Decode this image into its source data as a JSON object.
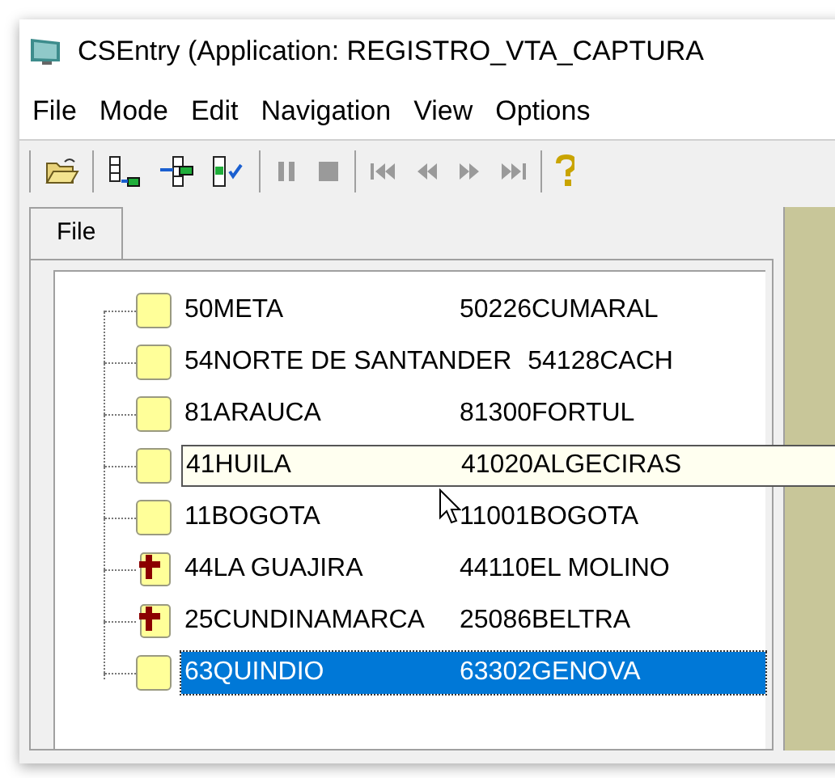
{
  "window": {
    "title": "CSEntry (Application: REGISTRO_VTA_CAPTURA"
  },
  "menu": [
    "File",
    "Mode",
    "Edit",
    "Navigation",
    "View",
    "Options"
  ],
  "toolbar": [
    [
      {
        "kind": "open",
        "disabled": false
      }
    ],
    [
      {
        "kind": "add",
        "disabled": false
      },
      {
        "kind": "insert",
        "disabled": false
      },
      {
        "kind": "verify",
        "disabled": false
      }
    ],
    [
      {
        "kind": "pause",
        "disabled": true
      },
      {
        "kind": "stop",
        "disabled": true
      }
    ],
    [
      {
        "kind": "first",
        "disabled": true
      },
      {
        "kind": "previous",
        "disabled": true
      },
      {
        "kind": "next",
        "disabled": true
      },
      {
        "kind": "last",
        "disabled": true
      }
    ],
    [
      {
        "kind": "help",
        "disabled": false
      }
    ]
  ],
  "tabs": [
    {
      "label": "File",
      "selected": true
    }
  ],
  "tree": [
    {
      "name": "50META",
      "location": "50226CUMARAL",
      "kind": "complete",
      "selected": false,
      "hovered": false
    },
    {
      "name": "54NORTE DE SANTANDER",
      "location": "54128CACH",
      "kind": "complete",
      "selected": false,
      "hovered": false
    },
    {
      "name": "81ARAUCA",
      "location": "81300FORTUL",
      "kind": "complete",
      "selected": false,
      "hovered": false
    },
    {
      "name": "41HUILA",
      "location": "41020ALGECIRAS",
      "kind": "complete",
      "selected": false,
      "hovered": true
    },
    {
      "name": "11BOGOTA",
      "location": "11001BOGOTA",
      "kind": "complete",
      "selected": false,
      "hovered": false
    },
    {
      "name": "44LA GUAJIRA",
      "location": "44110EL MOLINO",
      "kind": "partial",
      "selected": false,
      "hovered": false
    },
    {
      "name": "25CUNDINAMARCA",
      "location": "25086BELTRA",
      "kind": "partial",
      "selected": false,
      "hovered": false
    },
    {
      "name": "63QUINDIO",
      "location": "63302GENOVA",
      "kind": "complete",
      "selected": true,
      "hovered": false
    }
  ]
}
